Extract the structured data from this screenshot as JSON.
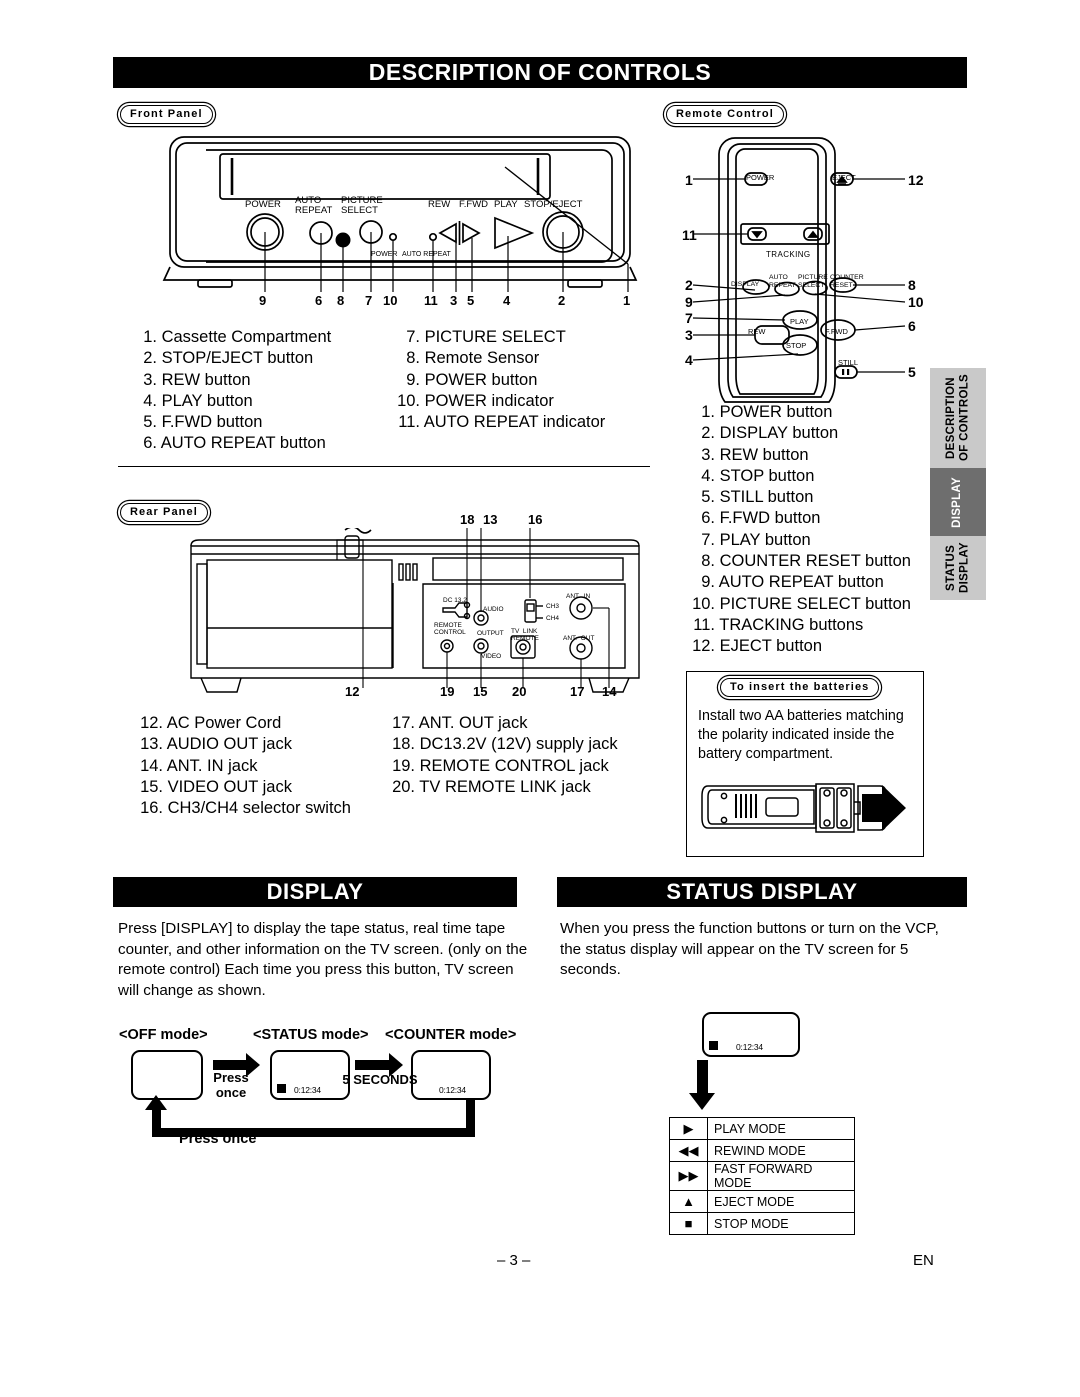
{
  "banners": {
    "main": "DESCRIPTION OF CONTROLS",
    "display": "DISPLAY",
    "status_display": "STATUS DISPLAY"
  },
  "captions": {
    "front_panel": "Front Panel",
    "remote_control": "Remote Control",
    "rear_panel": "Rear Panel",
    "batteries": "To insert the batteries"
  },
  "side_tab": {
    "description_of_controls": "DESCRIPTION OF CONTROLS",
    "display": "DISPLAY",
    "status_display": "STATUS DISPLAY",
    "colors": {
      "inactive_bg": "#c9c9c9",
      "active_bg": "#6e6e6e",
      "active_text": "#ffffff"
    }
  },
  "front_panel": {
    "diagram_labels": [
      "POWER",
      "AUTO REPEAT",
      "PICTURE SELECT",
      "REW",
      "F.FWD",
      "PLAY",
      "STOP/EJECT",
      "POWER",
      "AUTO REPEAT"
    ],
    "callouts": [
      "9",
      "6",
      "8",
      "7",
      "10",
      "11",
      "3",
      "5",
      "4",
      "2",
      "1"
    ],
    "items_left": [
      {
        "num": "1.",
        "label": "Cassette Compartment"
      },
      {
        "num": "2.",
        "label": "STOP/EJECT button"
      },
      {
        "num": "3.",
        "label": "REW button"
      },
      {
        "num": "4.",
        "label": "PLAY button"
      },
      {
        "num": "5.",
        "label": "F.FWD button"
      },
      {
        "num": "6.",
        "label": "AUTO REPEAT button"
      }
    ],
    "items_right": [
      {
        "num": "7.",
        "label": "PICTURE SELECT"
      },
      {
        "num": "8.",
        "label": "Remote Sensor"
      },
      {
        "num": "9.",
        "label": "POWER button"
      },
      {
        "num": "10.",
        "label": "POWER indicator"
      },
      {
        "num": "11.",
        "label": "AUTO REPEAT indicator"
      }
    ]
  },
  "remote_control": {
    "diagram_labels": [
      "POWER",
      "EJECT",
      "TRACKING",
      "DISPLAY",
      "AUTO REPEAT",
      "PICTURE SELECT",
      "COUNTER RESET",
      "PLAY",
      "REW",
      "STOP",
      "F.FWD",
      "STILL"
    ],
    "callouts": [
      "1",
      "12",
      "11",
      "2",
      "8",
      "9",
      "10",
      "7",
      "6",
      "3",
      "4",
      "5"
    ],
    "items": [
      {
        "num": "1.",
        "label": "POWER button"
      },
      {
        "num": "2.",
        "label": "DISPLAY button"
      },
      {
        "num": "3.",
        "label": "REW button"
      },
      {
        "num": "4.",
        "label": "STOP button"
      },
      {
        "num": "5.",
        "label": "STILL button"
      },
      {
        "num": "6.",
        "label": "F.FWD button"
      },
      {
        "num": "7.",
        "label": "PLAY button"
      },
      {
        "num": "8.",
        "label": "COUNTER RESET button"
      },
      {
        "num": "9.",
        "label": "AUTO REPEAT button"
      },
      {
        "num": "10.",
        "label": "PICTURE SELECT button"
      },
      {
        "num": "11.",
        "label": "TRACKING buttons"
      },
      {
        "num": "12.",
        "label": "EJECT button"
      }
    ]
  },
  "rear_panel": {
    "diagram_labels": [
      "DC 13.2",
      "AUDIO",
      "OUTPUT",
      "VIDEO",
      "REMOTE CONTROL",
      "CH3",
      "CH4",
      "TV LINK REMOTE",
      "ANT. IN",
      "ANT. OUT"
    ],
    "callouts_top": [
      "18",
      "13",
      "16"
    ],
    "callouts_bottom": [
      "12",
      "19",
      "15",
      "20",
      "17",
      "14"
    ],
    "items_left": [
      {
        "num": "12.",
        "label": "AC Power Cord"
      },
      {
        "num": "13.",
        "label": "AUDIO OUT jack"
      },
      {
        "num": "14.",
        "label": "ANT. IN jack"
      },
      {
        "num": "15.",
        "label": "VIDEO OUT jack"
      },
      {
        "num": "16.",
        "label": "CH3/CH4 selector switch"
      }
    ],
    "items_right": [
      {
        "num": "17.",
        "label": "ANT. OUT jack"
      },
      {
        "num": "18.",
        "label": "DC13.2V (12V) supply jack"
      },
      {
        "num": "19.",
        "label": "REMOTE CONTROL jack"
      },
      {
        "num": "20.",
        "label": "TV REMOTE LINK jack"
      }
    ]
  },
  "batteries": {
    "text": "Install two AA batteries matching the polarity indicated inside the battery compartment."
  },
  "display_section": {
    "paragraph": "Press [DISPLAY] to display the tape status, real time tape counter, and other information on the TV screen. (only on the remote control) Each time you press this button, TV screen will change as shown.",
    "modes": {
      "off": "<OFF mode>",
      "status": "<STATUS mode>",
      "counter": "<COUNTER mode>"
    },
    "arrow1_label": "Press once",
    "arrow2_label": "5 SECONDS",
    "return_label": "Press once",
    "counter_value": "0:12:34"
  },
  "status_section": {
    "paragraph": "When you press the function buttons or turn on the VCP, the status display will appear on the TV screen for 5 seconds.",
    "counter_value": "0:12:34",
    "mode_table": [
      {
        "icon": "play-icon",
        "glyph": "▶",
        "label": "PLAY MODE"
      },
      {
        "icon": "rewind-icon",
        "glyph": "◀◀",
        "label": "REWIND MODE"
      },
      {
        "icon": "fast-forward-icon",
        "glyph": "▶▶",
        "label": "FAST FORWARD MODE"
      },
      {
        "icon": "eject-icon",
        "glyph": "▲",
        "label": "EJECT MODE"
      },
      {
        "icon": "stop-icon",
        "glyph": "■",
        "label": "STOP MODE"
      }
    ]
  },
  "footer": {
    "page_number": "– 3 –",
    "language": "EN"
  }
}
